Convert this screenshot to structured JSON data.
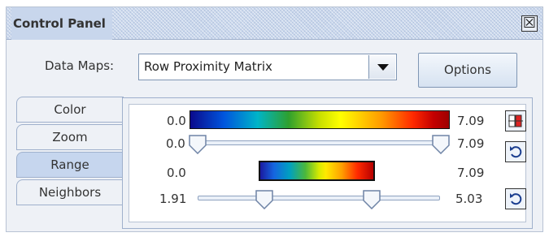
{
  "window": {
    "title": "Control Panel",
    "close_glyph": "☒"
  },
  "data_maps": {
    "label": "Data Maps:",
    "selected": "Row Proximity Matrix"
  },
  "options_label": "Options",
  "tabs": [
    {
      "label": "Color",
      "selected": false
    },
    {
      "label": "Zoom",
      "selected": false
    },
    {
      "label": "Range",
      "selected": true
    },
    {
      "label": "Neighbors",
      "selected": false
    }
  ],
  "range_panel": {
    "color_bar": {
      "min": "0.0",
      "max": "7.09"
    },
    "range_slider": {
      "min": "0.0",
      "max": "7.09",
      "low": 0.0,
      "high": 7.09
    },
    "preview_bar": {
      "min": "0.0",
      "max": "7.09"
    },
    "threshold_slider": {
      "min": "1.91",
      "max": "5.03",
      "low": 1.91,
      "high": 5.03
    }
  },
  "icons": {
    "color_picker": "color-palette-icon",
    "reset_range": "reset-icon",
    "reset_threshold": "reset-icon"
  },
  "colors": {
    "title_bar": "#c8d6ec",
    "selected_tab": "#c6d6ee",
    "panel_bg": "#eef1f6"
  }
}
